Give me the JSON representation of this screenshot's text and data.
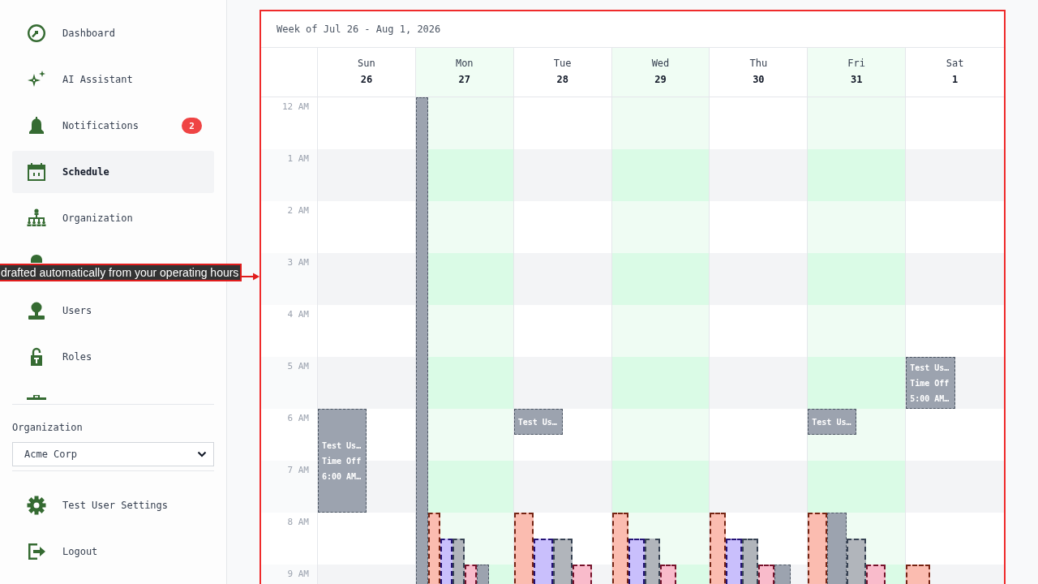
{
  "sidebar": {
    "nav_items": [
      {
        "label": "Dashboard",
        "selected": false
      },
      {
        "label": "AI Assistant",
        "selected": false
      },
      {
        "label": "Notifications",
        "selected": false,
        "badge": "2"
      },
      {
        "label": "Schedule",
        "selected": true
      },
      {
        "label": "Organization",
        "selected": false
      },
      {
        "label": "Users",
        "selected": false
      },
      {
        "label": "Roles",
        "selected": false
      }
    ],
    "organization": {
      "label": "Organization",
      "value": "Acme Corp"
    },
    "footer_items": [
      {
        "label": "Test User Settings"
      },
      {
        "label": "Logout"
      }
    ]
  },
  "calendar": {
    "title": "Week of Jul 26 - Aug 1, 2026",
    "highlighted": true,
    "hours": [
      "12 AM",
      "1 AM",
      "2 AM",
      "3 AM",
      "4 AM",
      "5 AM",
      "6 AM",
      "7 AM",
      "8 AM",
      "9 AM"
    ],
    "days": [
      {
        "name": "Sun",
        "date": "26",
        "highlighted": false,
        "events": [
          {
            "kind": "time_off",
            "title": "Test Us…",
            "label": "Time Off",
            "time": "6:00 AM…"
          }
        ]
      },
      {
        "name": "Mon",
        "date": "27",
        "highlighted": true,
        "events": [
          {
            "kind": "time_off"
          },
          {
            "kind": "shift",
            "color": "#fbbcb0"
          },
          {
            "kind": "shift",
            "color": "#c9bffc"
          },
          {
            "kind": "shift",
            "color": "#b1b5bb"
          },
          {
            "kind": "shift",
            "color": "#f9bbcb"
          },
          {
            "kind": "time_off"
          }
        ]
      },
      {
        "name": "Tue",
        "date": "28",
        "highlighted": false,
        "events": [
          {
            "kind": "time_off",
            "title": "Test Us…"
          },
          {
            "kind": "shift",
            "color": "#fbbcb0"
          },
          {
            "kind": "shift",
            "color": "#c9bffc"
          },
          {
            "kind": "shift",
            "color": "#b1b5bb"
          },
          {
            "kind": "shift",
            "color": "#f9bbcb"
          }
        ]
      },
      {
        "name": "Wed",
        "date": "29",
        "highlighted": true,
        "events": [
          {
            "kind": "shift",
            "color": "#fbbcb0"
          },
          {
            "kind": "shift",
            "color": "#c9bffc"
          },
          {
            "kind": "shift",
            "color": "#b1b5bb"
          },
          {
            "kind": "shift",
            "color": "#f9bbcb"
          }
        ]
      },
      {
        "name": "Thu",
        "date": "30",
        "highlighted": false,
        "events": [
          {
            "kind": "shift",
            "color": "#fbbcb0"
          },
          {
            "kind": "shift",
            "color": "#c9bffc"
          },
          {
            "kind": "shift",
            "color": "#b1b5bb"
          },
          {
            "kind": "shift",
            "color": "#f9bbcb"
          },
          {
            "kind": "time_off"
          }
        ]
      },
      {
        "name": "Fri",
        "date": "31",
        "highlighted": true,
        "events": [
          {
            "kind": "time_off",
            "title": "Test Us…"
          },
          {
            "kind": "shift",
            "color": "#fbbcb0"
          },
          {
            "kind": "time_off"
          },
          {
            "kind": "shift",
            "color": "#b1b5bb"
          },
          {
            "kind": "shift",
            "color": "#f9bbcb"
          }
        ]
      },
      {
        "name": "Sat",
        "date": "1",
        "highlighted": false,
        "events": [
          {
            "kind": "time_off",
            "title": "Test Us…",
            "label": "Time Off",
            "time": "5:00 AM…"
          },
          {
            "kind": "shift",
            "color": "#fbbcb0"
          }
        ]
      }
    ]
  },
  "tour_tooltip": {
    "text": "drafted automatically from your operating hours"
  }
}
